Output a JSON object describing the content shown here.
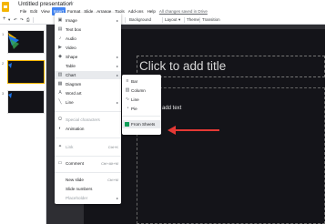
{
  "doc": {
    "title": "Untitled presentation",
    "star": "☆"
  },
  "menubar": [
    {
      "label": "File",
      "active": false
    },
    {
      "label": "Edit",
      "active": false
    },
    {
      "label": "View",
      "active": false
    },
    {
      "label": "Insert",
      "active": true
    },
    {
      "label": "Format",
      "active": false
    },
    {
      "label": "Slide",
      "active": false
    },
    {
      "label": "Arrange",
      "active": false
    },
    {
      "label": "Tools",
      "active": false
    },
    {
      "label": "Add-ons",
      "active": false
    },
    {
      "label": "Help",
      "active": false
    }
  ],
  "saved_note": "All changes saved in Drive",
  "toolbar": {
    "add_label": "+",
    "background_label": "Background",
    "layout_label": "Layout",
    "theme_label": "Theme",
    "transition_label": "Transition"
  },
  "filmstrip": {
    "slides": [
      {
        "num": "1"
      },
      {
        "num": "2"
      },
      {
        "num": "3"
      }
    ],
    "accent_color": "#1a73e8"
  },
  "slide": {
    "title_placeholder": "Click to add title",
    "body_placeholder": "add text"
  },
  "insert_menu": {
    "items": [
      {
        "icon": "image-icon",
        "glyph": "▣",
        "label": "Image",
        "submenu": true
      },
      {
        "icon": "text-box-icon",
        "glyph": "▤",
        "label": "Text box"
      },
      {
        "icon": "audio-icon",
        "glyph": "♪",
        "label": "Audio"
      },
      {
        "icon": "video-icon",
        "glyph": "▶",
        "label": "Video"
      },
      {
        "icon": "shape-icon",
        "glyph": "◆",
        "label": "Shape",
        "submenu": true
      },
      {
        "icon": "table-icon",
        "glyph": "",
        "label": "Table",
        "submenu": true
      },
      {
        "icon": "chart-icon",
        "glyph": "▥",
        "label": "Chart",
        "submenu": true,
        "highlighted": true
      },
      {
        "icon": "diagram-icon",
        "glyph": "▦",
        "label": "Diagram"
      },
      {
        "icon": "word-art-icon",
        "glyph": "A",
        "label": "Word art"
      },
      {
        "icon": "line-icon",
        "glyph": "╲",
        "label": "Line",
        "submenu": true
      },
      {
        "icon": "special-characters-icon",
        "glyph": "Ω",
        "label": "Special characters",
        "disabled": true
      },
      {
        "icon": "animation-icon",
        "glyph": "◐",
        "label": "Animation"
      },
      {
        "icon": "link-icon",
        "glyph": "⚭",
        "label": "Link",
        "shortcut": "Ctrl+K",
        "disabled": true
      },
      {
        "icon": "comment-icon",
        "glyph": "▭",
        "label": "Comment",
        "shortcut": "Ctrl+Alt+M"
      },
      {
        "icon": "new-slide-icon",
        "glyph": "",
        "label": "New slide",
        "shortcut": "Ctrl+M"
      },
      {
        "icon": "slide-numbers-icon",
        "glyph": "",
        "label": "Slide numbers"
      },
      {
        "icon": "placeholder-icon",
        "glyph": "",
        "label": "Placeholder",
        "submenu": true
      }
    ]
  },
  "chart_submenu": {
    "items": [
      {
        "icon": "bar-chart-icon",
        "glyph": "≡",
        "label": "Bar"
      },
      {
        "icon": "column-chart-icon",
        "glyph": "▥",
        "label": "Column"
      },
      {
        "icon": "line-chart-icon",
        "glyph": "∿",
        "label": "Line"
      },
      {
        "icon": "pie-chart-icon",
        "glyph": "◔",
        "label": "Pie"
      },
      {
        "icon": "sheets-icon",
        "glyph": "",
        "label": "From Sheets",
        "highlighted": true
      }
    ]
  },
  "annotation_color": "#e53935"
}
